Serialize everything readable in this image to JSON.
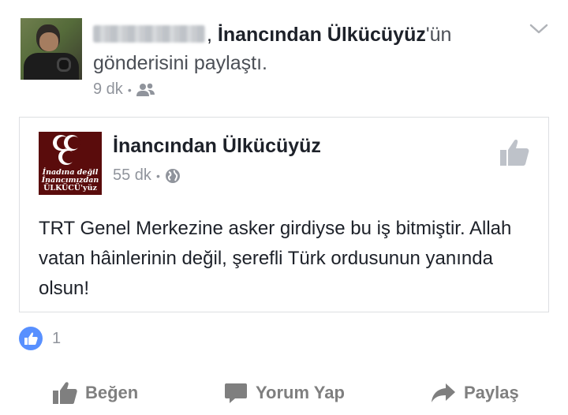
{
  "header": {
    "author_name": "Ferhat Ayaz",
    "shared_page": "İnancından Ülkücüyüz",
    "suffix_1": "'ün",
    "suffix_2": "gönderisini paylaştı.",
    "time": "9 dk",
    "audience_icon": "friends-icon"
  },
  "shared_post": {
    "page_name": "İnancından Ülkücüyüz",
    "time": "55 dk",
    "audience_icon": "globe-icon",
    "logo_text": [
      "İnadına değil",
      "İnancımızdan",
      "ÜLKÜCÜ'yüz"
    ],
    "body": "TRT Genel Merkezine asker girdiyse bu iş bitmiştir. Allah vatan hâinlerinin değil, şerefli Türk ordusunun yanında olsun!"
  },
  "reactions": {
    "count": "1",
    "icon": "like-reaction-icon",
    "color": "#5890ff"
  },
  "actions": {
    "like": "Beğen",
    "comment": "Yorum Yap",
    "share": "Paylaş"
  },
  "colors": {
    "text": "#1d2129",
    "muted": "#90949c",
    "action": "#7f7f7f",
    "border": "#dddfe2",
    "logo_bg": "#5a0c0c"
  }
}
